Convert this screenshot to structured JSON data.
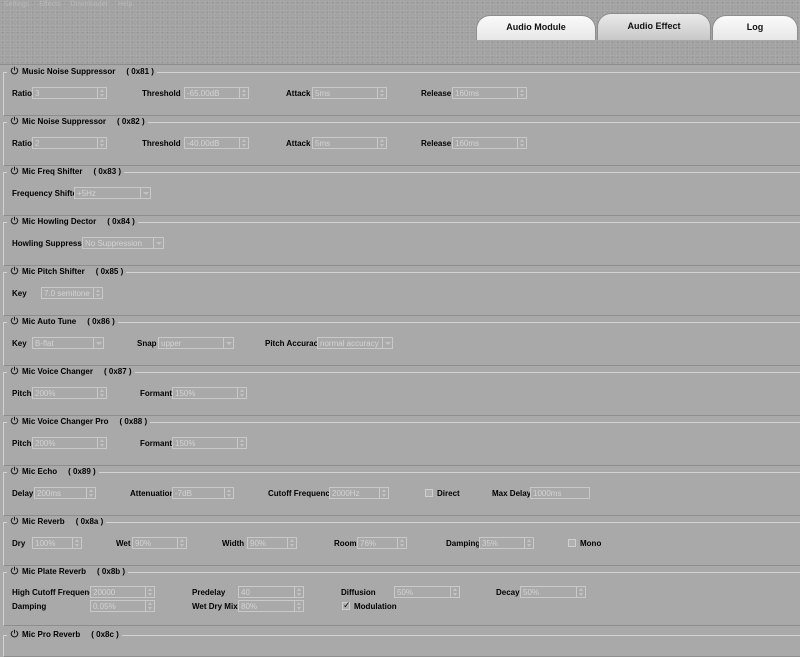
{
  "menu": [
    "Settings",
    "Effects",
    "Downloader",
    "Help"
  ],
  "tabs": [
    "Audio Module",
    "Audio Effect",
    "Log"
  ],
  "active_tab": "Audio Effect",
  "sections": [
    {
      "title": "Music Noise Suppressor",
      "code": "( 0x81 )",
      "rows": [
        [
          {
            "label": "Ratio",
            "value": "3"
          },
          {
            "label": "Threshold",
            "value": "-65.00dB"
          },
          {
            "label": "Attack",
            "value": "5ms"
          },
          {
            "label": "Release",
            "value": "160ms"
          }
        ]
      ]
    },
    {
      "title": "Mic Noise Suppressor",
      "code": "( 0x82 )",
      "rows": [
        [
          {
            "label": "Ratio",
            "value": "2"
          },
          {
            "label": "Threshold",
            "value": "-40.00dB"
          },
          {
            "label": "Attack",
            "value": "5ms"
          },
          {
            "label": "Release",
            "value": "160ms"
          }
        ]
      ]
    },
    {
      "title": "Mic Freq Shifter",
      "code": "( 0x83 )",
      "rows": [
        [
          {
            "label": "Frequency Shifter",
            "value": "+5Hz"
          }
        ]
      ]
    },
    {
      "title": "Mic Howling Dector",
      "code": "( 0x84 )",
      "rows": [
        [
          {
            "label": "Howling Suppressor",
            "value": "No Suppression"
          }
        ]
      ]
    },
    {
      "title": "Mic Pitch Shifter",
      "code": "( 0x85 )",
      "rows": [
        [
          {
            "label": "Key",
            "value": "7.0 semitone"
          }
        ]
      ]
    },
    {
      "title": "Mic Auto Tune",
      "code": "( 0x86 )",
      "rows": [
        [
          {
            "label": "Key",
            "value": "B-flat"
          },
          {
            "label": "Snap",
            "value": "upper"
          },
          {
            "label": "Pitch Accuracy",
            "value": "normal accuracy"
          }
        ]
      ]
    },
    {
      "title": "Mic Voice Changer",
      "code": "( 0x87 )",
      "rows": [
        [
          {
            "label": "Pitch",
            "value": "200%"
          },
          {
            "label": "Formant",
            "value": "150%"
          }
        ]
      ]
    },
    {
      "title": "Mic Voice Changer Pro",
      "code": "( 0x88 )",
      "rows": [
        [
          {
            "label": "Pitch",
            "value": "200%"
          },
          {
            "label": "Formant",
            "value": "150%"
          }
        ]
      ]
    },
    {
      "title": "Mic Echo",
      "code": "( 0x89 )",
      "rows": [
        [
          {
            "label": "Delay",
            "value": "200ms"
          },
          {
            "label": "Attenuation",
            "value": "-7dB"
          },
          {
            "label": "Cutoff Frequency",
            "value": "2000Hz"
          },
          {
            "label": "Direct",
            "checked": false
          },
          {
            "label": "Max Delay",
            "value": "1000ms"
          }
        ]
      ]
    },
    {
      "title": "Mic Reverb",
      "code": "( 0x8a )",
      "rows": [
        [
          {
            "label": "Dry",
            "value": "100%"
          },
          {
            "label": "Wet",
            "value": "90%"
          },
          {
            "label": "Width",
            "value": "90%"
          },
          {
            "label": "Room",
            "value": "76%"
          },
          {
            "label": "Damping",
            "value": "35%"
          },
          {
            "label": "Mono",
            "checked": false
          }
        ]
      ]
    },
    {
      "title": "Mic Plate Reverb",
      "code": "( 0x8b )",
      "rows": [
        [
          {
            "label": "High Cutoff Frequency",
            "value": "20000"
          },
          {
            "label": "Predelay",
            "value": "40"
          },
          {
            "label": "Diffusion",
            "value": "50%"
          },
          {
            "label": "Decay",
            "value": "50%"
          }
        ],
        [
          {
            "label": "Damping",
            "value": "0.05%"
          },
          {
            "label": "Wet Dry Mix",
            "value": "80%"
          },
          {
            "label": "Modulation",
            "checked": true
          }
        ]
      ]
    },
    {
      "title": "Mic Pro Reverb",
      "code": "( 0x8c )",
      "rows": []
    }
  ]
}
